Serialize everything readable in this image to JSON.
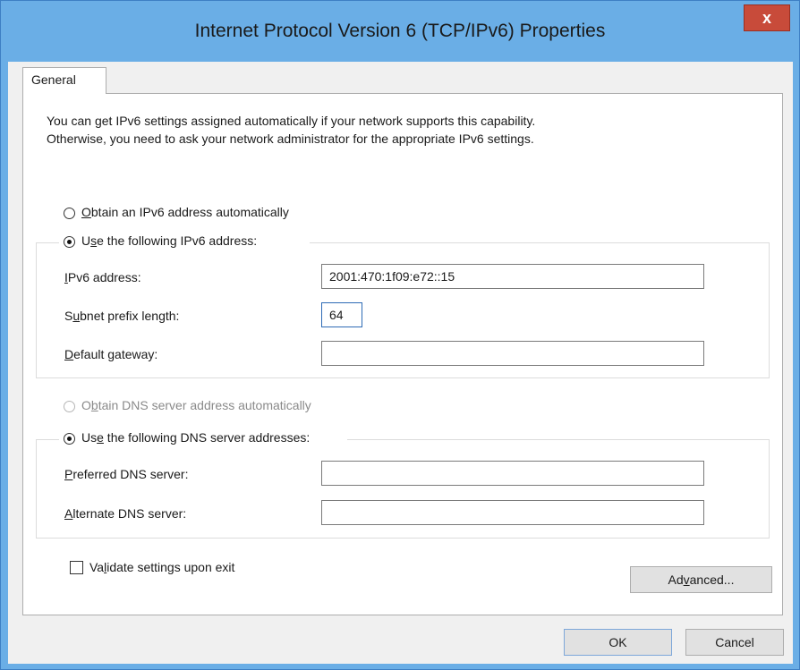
{
  "window": {
    "title": "Internet Protocol Version 6 (TCP/IPv6) Properties",
    "close_glyph": "x"
  },
  "tabs": [
    {
      "label": "General",
      "selected": true
    }
  ],
  "description": {
    "line1": "You can get IPv6 settings assigned automatically if your network supports this capability.",
    "line2": "Otherwise, you need to ask your network administrator for the appropriate IPv6 settings."
  },
  "address_mode": {
    "auto": {
      "pre": "",
      "mnemonic": "O",
      "post": "btain an IPv6 address automatically",
      "checked": false
    },
    "manual": {
      "pre": "U",
      "mnemonic": "s",
      "post": "e the following IPv6 address:",
      "checked": true
    }
  },
  "address_fields": {
    "ipv6": {
      "pre": "",
      "mnemonic": "I",
      "post": "Pv6 address:",
      "value": "2001:470:1f09:e72::15"
    },
    "prefix": {
      "pre": "S",
      "mnemonic": "u",
      "post": "bnet prefix length:",
      "value": "64"
    },
    "gateway": {
      "pre": "",
      "mnemonic": "D",
      "post": "efault gateway:",
      "value": ""
    }
  },
  "dns_mode": {
    "auto": {
      "pre": "O",
      "mnemonic": "b",
      "post": "tain DNS server address automatically",
      "checked": false,
      "enabled": false
    },
    "manual": {
      "pre": "Us",
      "mnemonic": "e",
      "post": " the following DNS server addresses:",
      "checked": true
    }
  },
  "dns_fields": {
    "preferred": {
      "pre": "",
      "mnemonic": "P",
      "post": "referred DNS server:",
      "value": ""
    },
    "alternate": {
      "pre": "",
      "mnemonic": "A",
      "post": "lternate DNS server:",
      "value": ""
    }
  },
  "validate": {
    "pre": "Va",
    "mnemonic": "l",
    "post": "idate settings upon exit",
    "checked": false
  },
  "buttons": {
    "advanced": {
      "pre": "Ad",
      "mnemonic": "v",
      "post": "anced..."
    },
    "ok": "OK",
    "cancel": "Cancel"
  }
}
